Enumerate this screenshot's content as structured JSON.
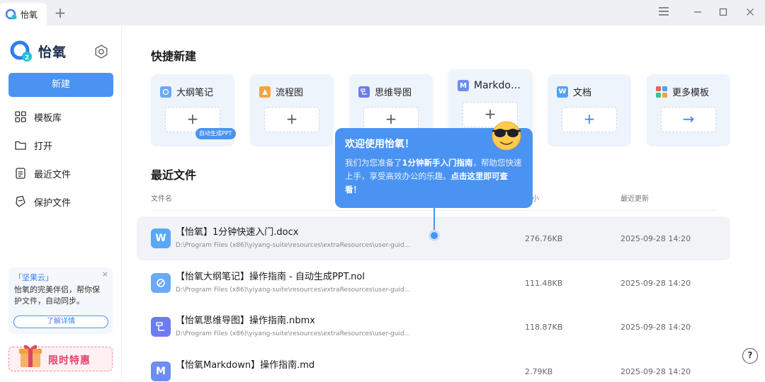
{
  "titlebar": {
    "tab_label": "怡氧",
    "add_tab": "+",
    "menu_icon": "menu-icon",
    "minimize_icon": "minimize-icon",
    "maximize_icon": "maximize-icon",
    "close_icon": "close-icon"
  },
  "sidebar": {
    "logo_text": "怡氧",
    "new_button": "新建",
    "nav": [
      {
        "label": "模板库",
        "icon": "template-grid-icon"
      },
      {
        "label": "打开",
        "icon": "folder-icon"
      },
      {
        "label": "最近文件",
        "icon": "recent-document-icon"
      },
      {
        "label": "保护文件",
        "icon": "shield-file-icon"
      }
    ],
    "promo": {
      "title": "「坚果云」",
      "text": "怡氧的完美伴侣，帮你保护文件，自动同步。",
      "button": "了解详情",
      "close": "×"
    },
    "offer": "限时特惠"
  },
  "quick_create": {
    "title": "快捷新建",
    "cards": [
      {
        "label": "大纲笔记",
        "icon": "outline-note-icon",
        "color": "#6aa9f4",
        "action": "+",
        "badge": "自动生成PPT"
      },
      {
        "label": "流程图",
        "icon": "flowchart-icon",
        "color": "#f4a340",
        "action": "+"
      },
      {
        "label": "思维导图",
        "icon": "mindmap-icon",
        "color": "#6c7bf0",
        "action": "+"
      },
      {
        "label": "Markdo…",
        "icon": "markdown-icon",
        "color": "#6c8ef0",
        "action": "+"
      },
      {
        "label": "文档",
        "icon": "word-doc-icon",
        "color": "#4ea3f2",
        "action": "+"
      },
      {
        "label": "更多模板",
        "icon": "more-templates-icon",
        "color": "#f0604d",
        "action": "→"
      }
    ]
  },
  "recent": {
    "title": "最近文件",
    "col_name": "文件名",
    "col_size": "小",
    "col_updated": "最近更新",
    "files": [
      {
        "name": "【怡氧】1分钟快速入门.docx",
        "path": "D:\\Program Files (x86)\\yiyang-suite\\resources\\extraResources\\user-guid...",
        "size": "276.76KB",
        "date": "2025-09-28 14:20",
        "icon_letter": "W",
        "icon": "word-file-icon",
        "color": "#5aa8f5"
      },
      {
        "name": "【怡氧大纲笔记】操作指南 - 自动生成PPT.nol",
        "path": "D:\\Program Files (x86)\\yiyang-suite\\resources\\extraResources\\user-guid...",
        "size": "111.48KB",
        "date": "2025-09-28 14:20",
        "icon_letter": "",
        "icon": "outline-file-icon",
        "color": "#6aa9f4"
      },
      {
        "name": "【怡氧思维导图】操作指南.nbmx",
        "path": "D:\\Program Files (x86)\\yiyang-suite\\resources\\extraResources\\user-guid...",
        "size": "118.87KB",
        "date": "2025-09-28 14:20",
        "icon_letter": "",
        "icon": "mindmap-file-icon",
        "color": "#6c7bf0"
      },
      {
        "name": "【怡氧Markdown】操作指南.md",
        "path": "",
        "size": "2.79KB",
        "date": "2025-09-28 14:20",
        "icon_letter": "M",
        "icon": "markdown-file-icon",
        "color": "#6c8ef0"
      }
    ]
  },
  "tooltip": {
    "title": "欢迎使用怡氧！",
    "text_1": "我们为您准备了",
    "text_bold_1": "1分钟新手入门指南",
    "text_2": "，帮助您快速上手，享受高效办公的乐趣。",
    "text_bold_2": "点击这里即可查看！"
  },
  "help": "?"
}
